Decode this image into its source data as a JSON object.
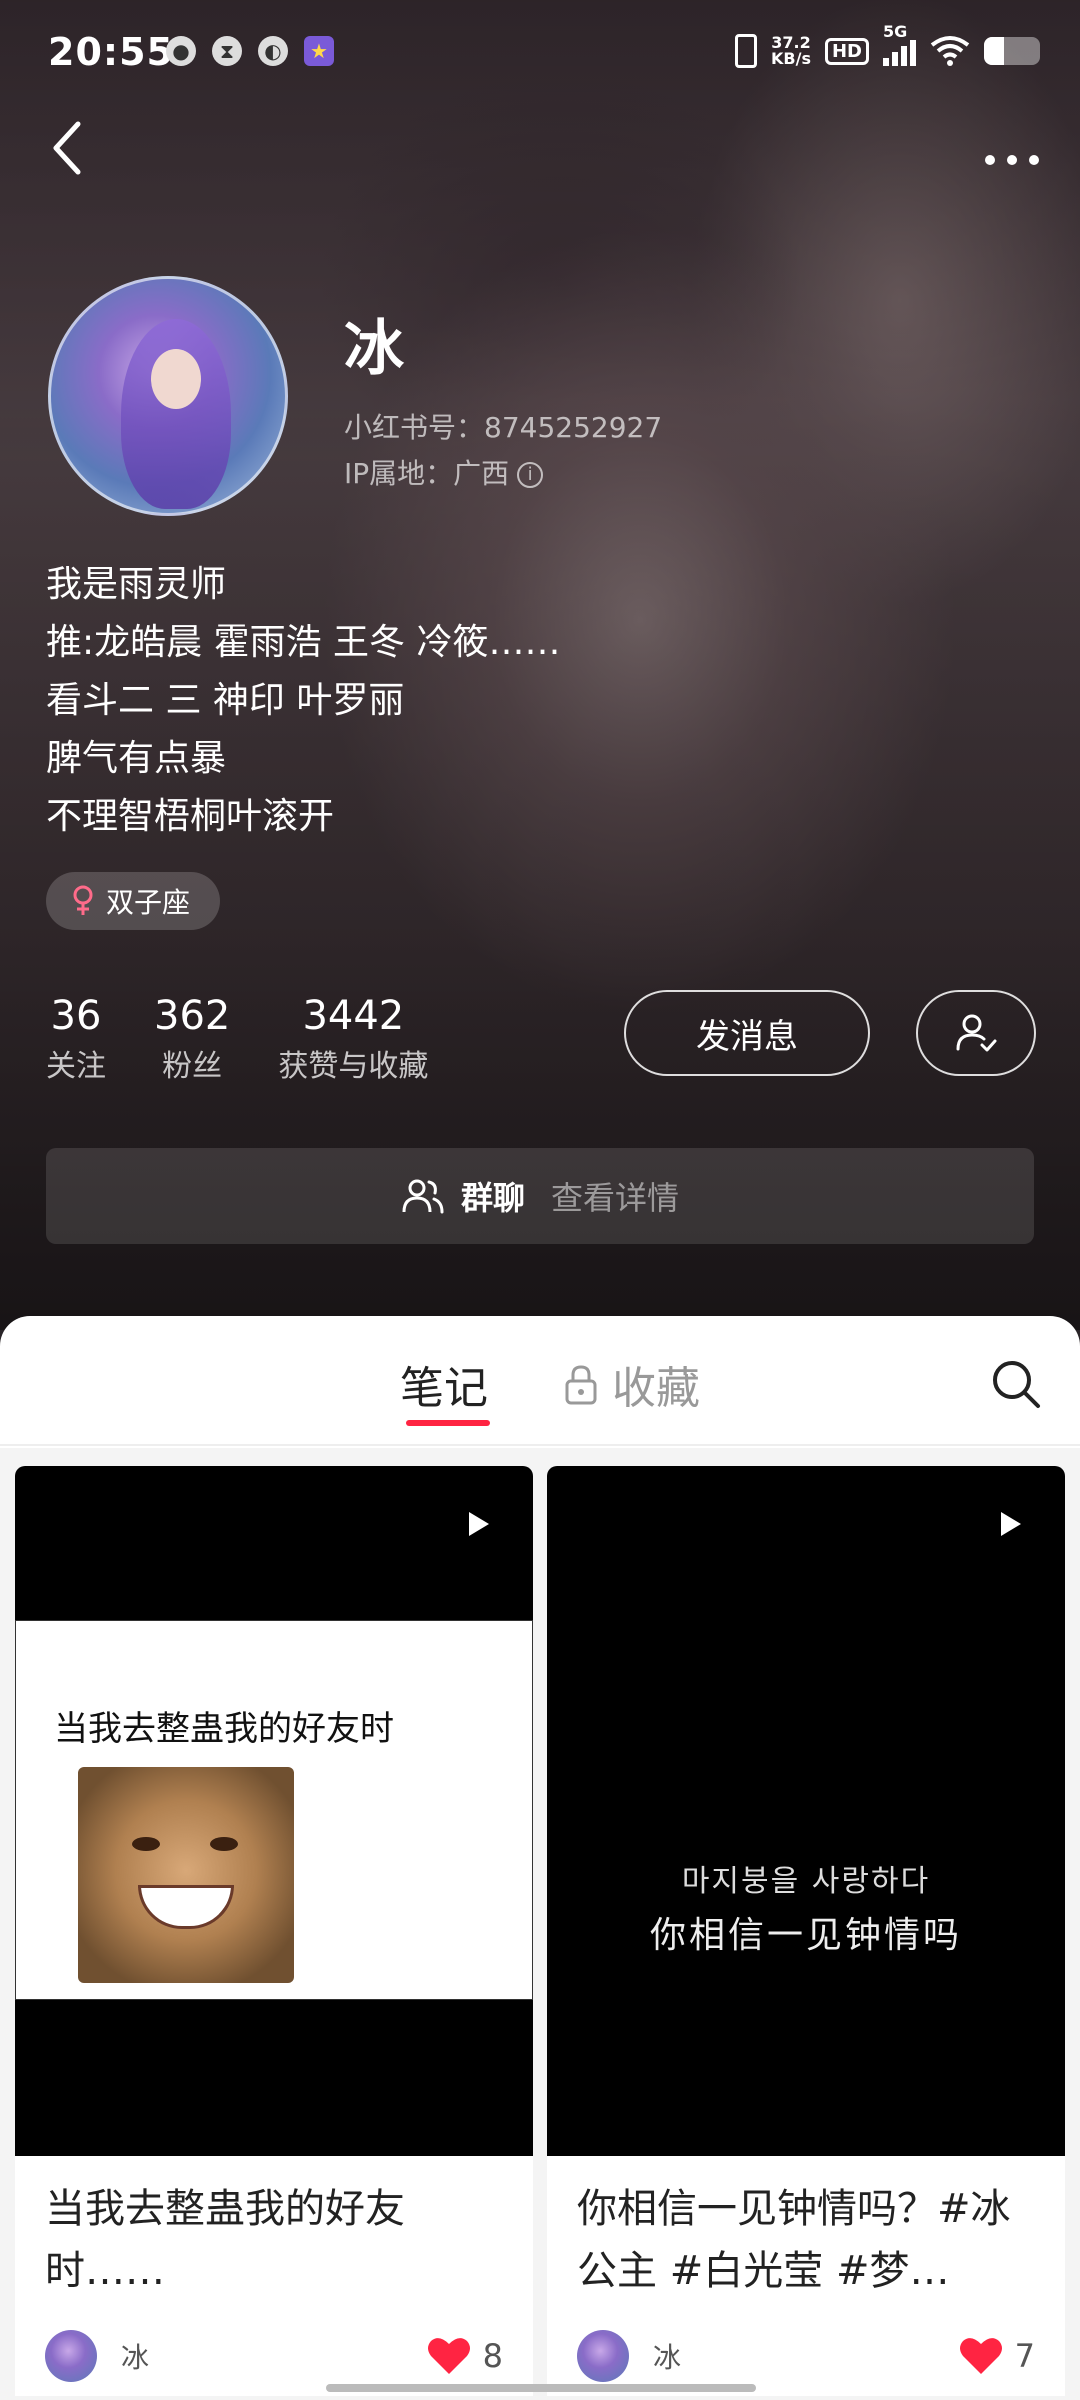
{
  "status_bar": {
    "time": "20:55",
    "net_speed_value": "37.2",
    "net_speed_unit": "KB/s",
    "hd": "HD",
    "network": "5G",
    "battery_level": 0.35
  },
  "profile": {
    "name": "冰",
    "id_line": "小红书号：8745252927",
    "ip_line": "IP属地：广西",
    "bio": [
      "我是雨灵师",
      "推:龙皓晨 霍雨浩 王冬 冷筱……",
      "看斗二 三 神印 叶罗丽",
      "脾气有点暴",
      "不理智梧桐叶滚开"
    ],
    "zodiac_tag": "双子座"
  },
  "stats": [
    {
      "value": "36",
      "label": "关注"
    },
    {
      "value": "362",
      "label": "粉丝"
    },
    {
      "value": "3442",
      "label": "获赞与收藏"
    }
  ],
  "actions": {
    "message_label": "发消息"
  },
  "group_chat": {
    "label": "群聊",
    "sub": "查看详情"
  },
  "tabs": {
    "notes": "笔记",
    "collections": "收藏"
  },
  "notes": [
    {
      "cover_text": "当我去整蛊我的好友时",
      "title": "当我去整蛊我的好友时……",
      "author": "冰",
      "likes": "8"
    },
    {
      "cover_line1": "마지붕을 사랑하다",
      "cover_line2": "你相信一见钟情吗",
      "title": "你相信一见钟情吗？#冰公主 #白光莹 #梦…",
      "author": "冰",
      "likes": "7"
    }
  ],
  "colors": {
    "accent": "#ff2442",
    "female": "#ff6b8a"
  }
}
